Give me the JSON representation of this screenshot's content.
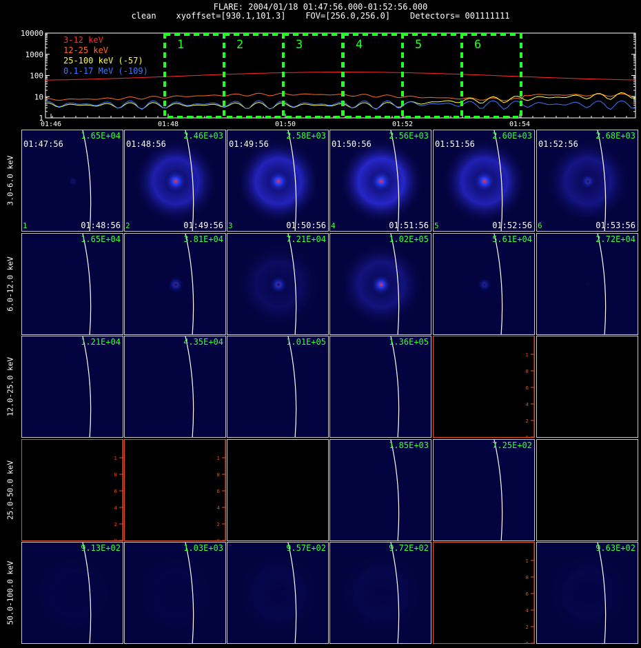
{
  "header": {
    "title": "FLARE: 2004/01/18 01:47:56.000-01:52:56.000",
    "subtitle": "clean    xyoffset=[930.1,101.3]    FOV=[256.0,256.0]    Detectors= 001111111"
  },
  "lightcurve": {
    "y_ticks": [
      "10000",
      "1000",
      "100",
      "10",
      "1"
    ],
    "x_ticks": [
      "01:46",
      "01:48",
      "01:50",
      "01:52",
      "01:54"
    ],
    "legend": [
      {
        "label": "3-12 keV",
        "color": "#ff2a2a"
      },
      {
        "label": "12-25 keV",
        "color": "#ff6a1a"
      },
      {
        "label": "25-100 keV (-57)",
        "color": "#ffff40"
      },
      {
        "label": "0.1-17 MeV (-109)",
        "color": "#3a78ff"
      }
    ],
    "intervals": [
      "1",
      "2",
      "3",
      "4",
      "5",
      "6"
    ],
    "interval_color": "#22ff22"
  },
  "row_labels": [
    "3.0-6.0 keV",
    "6.0-12.0 keV",
    "12.0-25.0 keV",
    "25.0-50.0 keV",
    "50.0-100.0 keV"
  ],
  "time_starts": [
    "01:47:56",
    "01:48:56",
    "01:49:56",
    "01:50:56",
    "01:51:56",
    "01:52:56"
  ],
  "time_ends": [
    "01:48:56",
    "01:49:56",
    "01:50:56",
    "01:51:56",
    "01:52:56",
    "01:53:56"
  ],
  "panel_indices": [
    "1",
    "2",
    "3",
    "4",
    "5",
    "6"
  ],
  "panel_max": [
    [
      "1.65E+04",
      "2.46E+03",
      "2.58E+03",
      "2.56E+03",
      "2.60E+03",
      "2.68E+03"
    ],
    [
      "1.65E+04",
      "3.81E+04",
      "7.21E+04",
      "1.02E+05",
      "5.61E+04",
      "2.72E+04"
    ],
    [
      "1.21E+04",
      "4.35E+04",
      "1.01E+05",
      "1.36E+05",
      "",
      ""
    ],
    [
      "",
      "",
      "",
      "1.85E+03",
      "7.25E+02",
      ""
    ],
    [
      "9.13E+02",
      "1.03E+03",
      "9.57E+02",
      "9.72E+02",
      "",
      "9.63E+02"
    ]
  ],
  "empty_axis_ticks": [
    "0",
    "2",
    "4",
    "6",
    "8",
    "1"
  ]
}
